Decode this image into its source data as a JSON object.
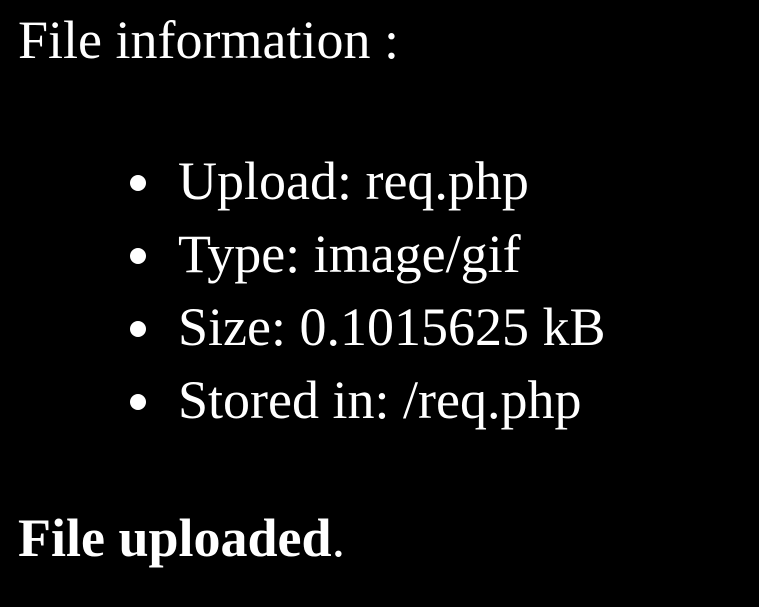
{
  "heading": "File information :",
  "file_info": {
    "upload": "Upload: req.php",
    "type": "Type: image/gif",
    "size": "Size: 0.1015625 kB",
    "stored": "Stored in: /req.php"
  },
  "status": {
    "message": "File uploaded",
    "punctuation": "."
  },
  "colors": {
    "background": "#000000",
    "text": "#ffffff"
  }
}
